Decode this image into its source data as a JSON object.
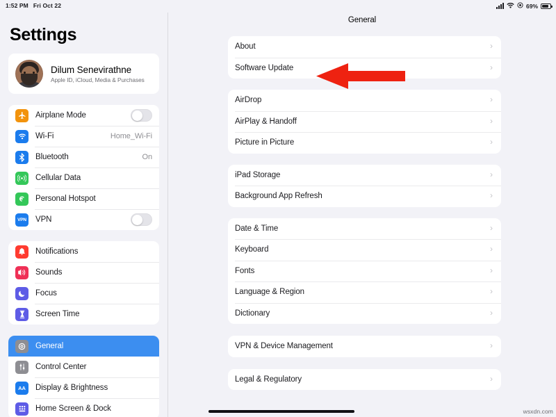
{
  "statusbar": {
    "time": "1:52 PM",
    "date": "Fri Oct 22",
    "battery_percent": "69%",
    "icons": [
      "cellular-signal-icon",
      "wifi-icon",
      "location-icon",
      "battery-icon"
    ]
  },
  "sidebar": {
    "title": "Settings",
    "profile": {
      "name": "Dilum Senevirathne",
      "subtitle": "Apple ID, iCloud, Media & Purchases",
      "avatar": "user-avatar"
    },
    "groups": [
      {
        "items": [
          {
            "label": "Airplane Mode",
            "icon": "airplane-icon",
            "icon_color": "#f2930d",
            "control": "toggle",
            "toggle_on": false
          },
          {
            "label": "Wi-Fi",
            "icon": "wifi-icon",
            "icon_color": "#1b7ced",
            "value": "Home_Wi-Fi"
          },
          {
            "label": "Bluetooth",
            "icon": "bluetooth-icon",
            "icon_color": "#1b7ced",
            "value": "On"
          },
          {
            "label": "Cellular Data",
            "icon": "cellular-data-icon",
            "icon_color": "#34c759"
          },
          {
            "label": "Personal Hotspot",
            "icon": "personal-hotspot-icon",
            "icon_color": "#34c759"
          },
          {
            "label": "VPN",
            "icon": "vpn-icon",
            "icon_color": "#1b7ced",
            "control": "toggle",
            "toggle_on": false
          }
        ]
      },
      {
        "items": [
          {
            "label": "Notifications",
            "icon": "bell-icon",
            "icon_color": "#ff3b30"
          },
          {
            "label": "Sounds",
            "icon": "speaker-icon",
            "icon_color": "#ef3056"
          },
          {
            "label": "Focus",
            "icon": "moon-icon",
            "icon_color": "#5e5ce6"
          },
          {
            "label": "Screen Time",
            "icon": "hourglass-icon",
            "icon_color": "#5e5ce6"
          }
        ]
      },
      {
        "items": [
          {
            "label": "General",
            "icon": "gear-icon",
            "icon_color": "#8e8e93",
            "selected": true
          },
          {
            "label": "Control Center",
            "icon": "control-center-icon",
            "icon_color": "#8e8e93"
          },
          {
            "label": "Display & Brightness",
            "icon": "display-brightness-icon",
            "icon_color": "#1b7ced"
          },
          {
            "label": "Home Screen & Dock",
            "icon": "home-screen-dock-icon",
            "icon_color": "#5e5ce6"
          }
        ]
      }
    ]
  },
  "main": {
    "title": "General",
    "groups": [
      {
        "items": [
          {
            "label": "About"
          },
          {
            "label": "Software Update"
          }
        ]
      },
      {
        "items": [
          {
            "label": "AirDrop"
          },
          {
            "label": "AirPlay & Handoff"
          },
          {
            "label": "Picture in Picture"
          }
        ]
      },
      {
        "items": [
          {
            "label": "iPad Storage"
          },
          {
            "label": "Background App Refresh"
          }
        ]
      },
      {
        "items": [
          {
            "label": "Date & Time"
          },
          {
            "label": "Keyboard"
          },
          {
            "label": "Fonts"
          },
          {
            "label": "Language & Region"
          },
          {
            "label": "Dictionary"
          }
        ]
      },
      {
        "items": [
          {
            "label": "VPN & Device Management"
          }
        ]
      },
      {
        "items": [
          {
            "label": "Legal & Regulatory"
          }
        ]
      }
    ],
    "chevron": "›"
  },
  "annotation": {
    "arrow": "red-left-arrow",
    "arrow_color": "#ee2211",
    "points_at": "Software Update"
  },
  "watermark": "wsxdn.com"
}
